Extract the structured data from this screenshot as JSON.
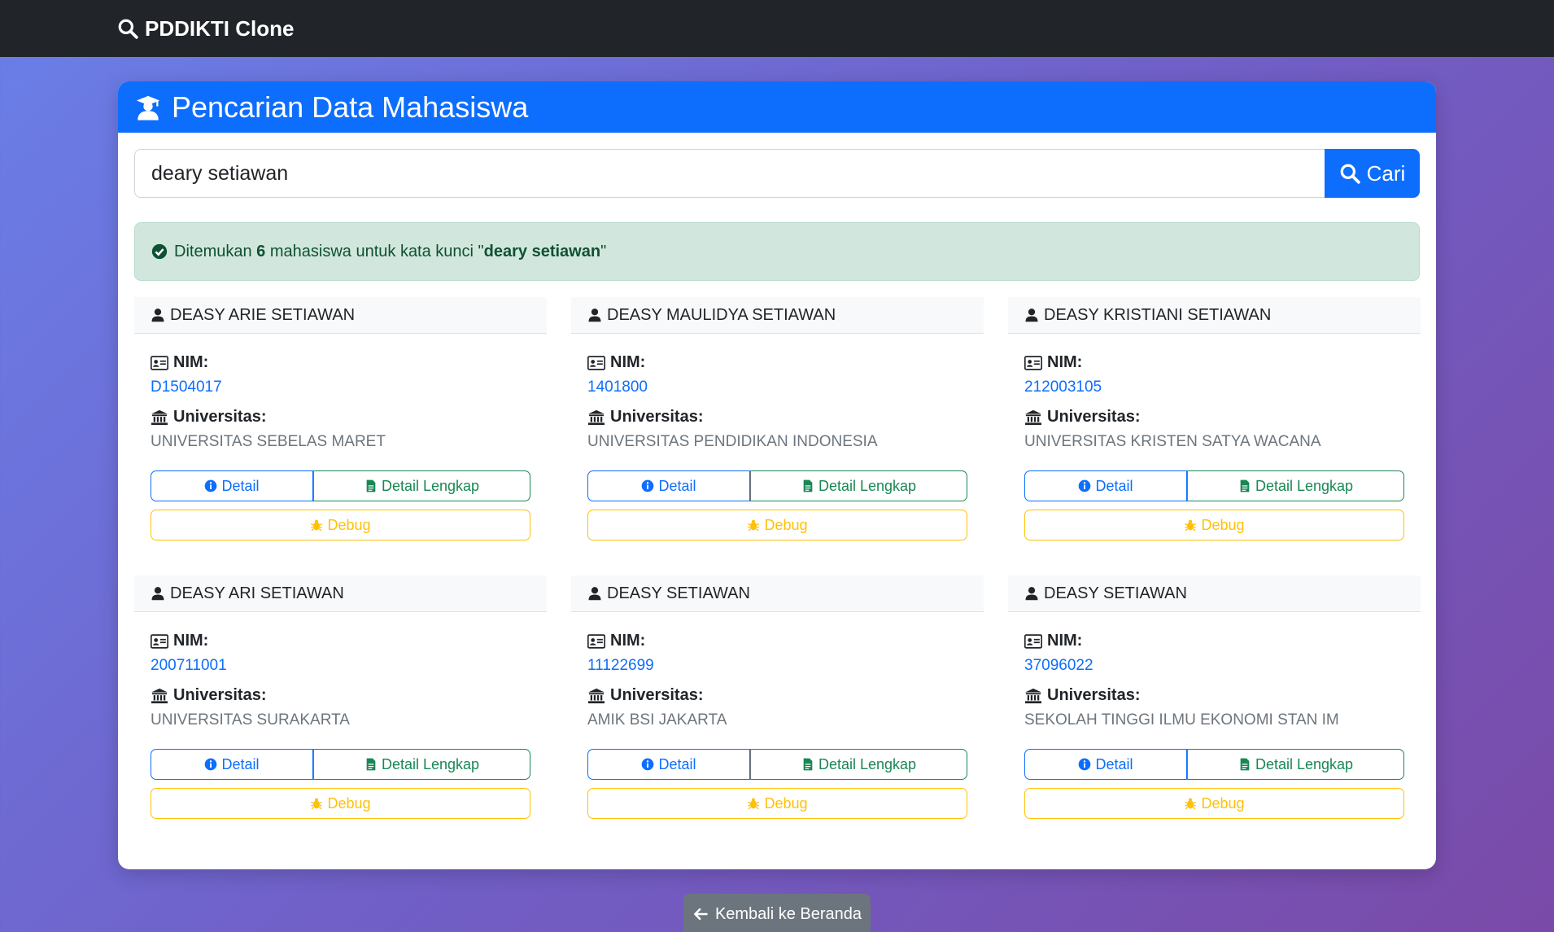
{
  "navbar": {
    "brand": "PDDIKTI Clone"
  },
  "page": {
    "title": "Pencarian Data Mahasiswa"
  },
  "search": {
    "value": "deary setiawan",
    "button_label": "Cari"
  },
  "alert": {
    "prefix": "Ditemukan",
    "count": "6",
    "middle": "mahasiswa untuk kata kunci \"",
    "keyword": "deary setiawan",
    "suffix": "\""
  },
  "labels": {
    "nim": "NIM:",
    "universitas": "Universitas:",
    "detail": "Detail",
    "detail_lengkap": "Detail Lengkap",
    "debug": "Debug"
  },
  "results": [
    {
      "name": "DEASY ARIE SETIAWAN",
      "nim": "D1504017",
      "university": "UNIVERSITAS SEBELAS MARET"
    },
    {
      "name": "DEASY MAULIDYA SETIAWAN",
      "nim": "1401800",
      "university": "UNIVERSITAS PENDIDIKAN INDONESIA"
    },
    {
      "name": "DEASY KRISTIANI SETIAWAN",
      "nim": "212003105",
      "university": "UNIVERSITAS KRISTEN SATYA WACANA"
    },
    {
      "name": "DEASY ARI SETIAWAN",
      "nim": "200711001",
      "university": "UNIVERSITAS SURAKARTA"
    },
    {
      "name": "DEASY SETIAWAN",
      "nim": "11122699",
      "university": "AMIK BSI JAKARTA"
    },
    {
      "name": "DEASY SETIAWAN",
      "nim": "37096022",
      "university": "SEKOLAH TINGGI ILMU EKONOMI STAN IM"
    }
  ],
  "footer": {
    "back_label": "Kembali ke Beranda"
  },
  "colors": {
    "navbar": "#212529",
    "primary": "#0d6efd",
    "success": "#198754",
    "warning": "#ffc107",
    "secondary": "#6c757d",
    "alert_bg": "#d1e7dd"
  },
  "icons": {
    "brand": "search-icon",
    "header": "graduate-icon",
    "search_button": "search-icon",
    "alert": "check-circle-icon",
    "card_header": "user-icon",
    "nim": "id-card-icon",
    "university": "university-icon",
    "detail": "info-circle-icon",
    "detail_lengkap": "file-icon",
    "debug": "bug-icon",
    "back": "arrow-left-icon"
  }
}
